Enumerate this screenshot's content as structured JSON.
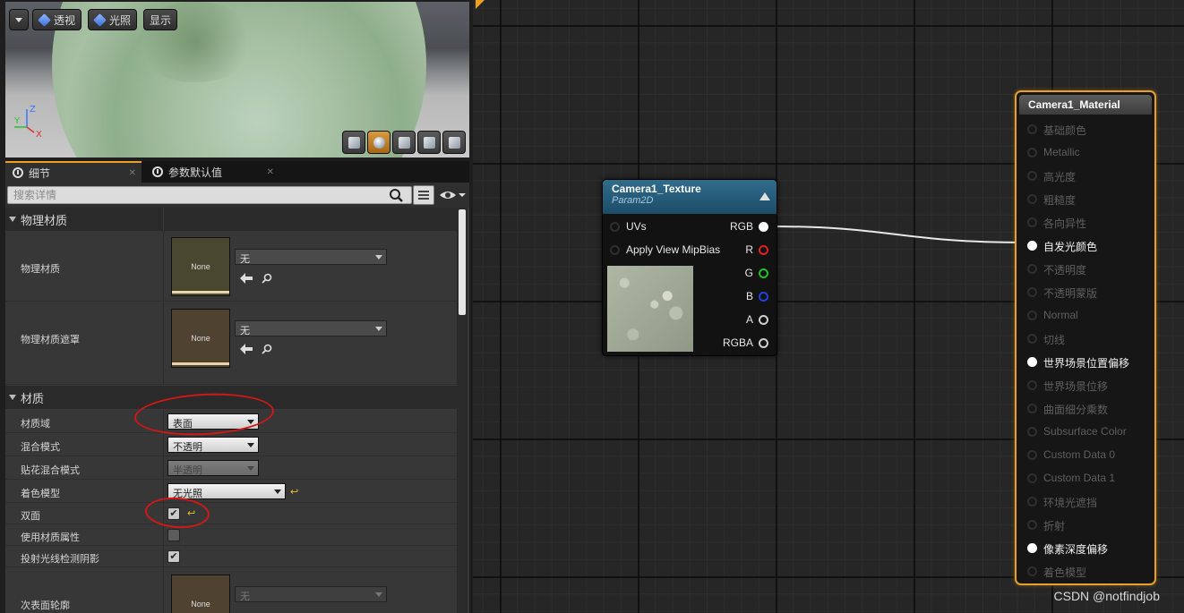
{
  "viewport": {
    "dropdown_label": "",
    "perspective_label": "透视",
    "lit_label": "光照",
    "show_label": "显示",
    "axes": {
      "z": "Z",
      "y": "Y",
      "x": "X"
    }
  },
  "tabs": [
    {
      "label": "细节",
      "icon": "magnifier-icon",
      "active": true
    },
    {
      "label": "参数默认值",
      "icon": "magnifier-icon",
      "active": false
    }
  ],
  "search": {
    "placeholder": "搜索详情",
    "value": ""
  },
  "categories": {
    "physical_material": "物理材质",
    "material": "材质"
  },
  "physical_rows": [
    {
      "label": "物理材质",
      "thumb": "None",
      "value": "无"
    },
    {
      "label": "物理材质遮罩",
      "thumb": "None",
      "value": "无"
    }
  ],
  "material_rows": {
    "domain": {
      "label": "材质域",
      "value": "表面"
    },
    "blend": {
      "label": "混合模式",
      "value": "不透明"
    },
    "decal_blend": {
      "label": "贴花混合模式",
      "value": "半透明"
    },
    "shading": {
      "label": "着色模型",
      "value": "无光照"
    },
    "two_sided": {
      "label": "双面",
      "checked": true
    },
    "use_attrs": {
      "label": "使用材质属性",
      "checked": false
    },
    "cast_ray": {
      "label": "投射光线检测阴影",
      "checked": true
    },
    "subsurface": {
      "label": "次表面轮廓",
      "thumb": "None",
      "value": "无"
    }
  },
  "texture_node": {
    "title": "Camera1_Texture",
    "subtitle": "Param2D",
    "inputs": [
      "UVs",
      "Apply View MipBias"
    ],
    "outputs": [
      "RGB",
      "R",
      "G",
      "B",
      "A",
      "RGBA"
    ],
    "output_colors": [
      "#ffffff",
      "#e02020",
      "#20c020",
      "#2040e0",
      "#cfcfcf",
      "#cfcfcf"
    ]
  },
  "material_node": {
    "title": "Camera1_Material",
    "pins": [
      {
        "label": "基础颜色",
        "active": false
      },
      {
        "label": "Metallic",
        "active": false
      },
      {
        "label": "高光度",
        "active": false
      },
      {
        "label": "粗糙度",
        "active": false
      },
      {
        "label": "各向异性",
        "active": false
      },
      {
        "label": "自发光颜色",
        "active": true
      },
      {
        "label": "不透明度",
        "active": false
      },
      {
        "label": "不透明蒙版",
        "active": false
      },
      {
        "label": "Normal",
        "active": false
      },
      {
        "label": "切线",
        "active": false
      },
      {
        "label": "世界场景位置偏移",
        "active": true
      },
      {
        "label": "世界场景位移",
        "active": false
      },
      {
        "label": "曲面细分乘数",
        "active": false
      },
      {
        "label": "Subsurface Color",
        "active": false
      },
      {
        "label": "Custom Data 0",
        "active": false
      },
      {
        "label": "Custom Data 1",
        "active": false
      },
      {
        "label": "环境光遮挡",
        "active": false
      },
      {
        "label": "折射",
        "active": false
      },
      {
        "label": "像素深度偏移",
        "active": true
      },
      {
        "label": "着色模型",
        "active": false
      }
    ]
  },
  "watermark": "CSDN @notfindjob",
  "colors": {
    "accent": "#f0a020",
    "annotation": "#d01818",
    "texture_header": "#1c4d68"
  }
}
